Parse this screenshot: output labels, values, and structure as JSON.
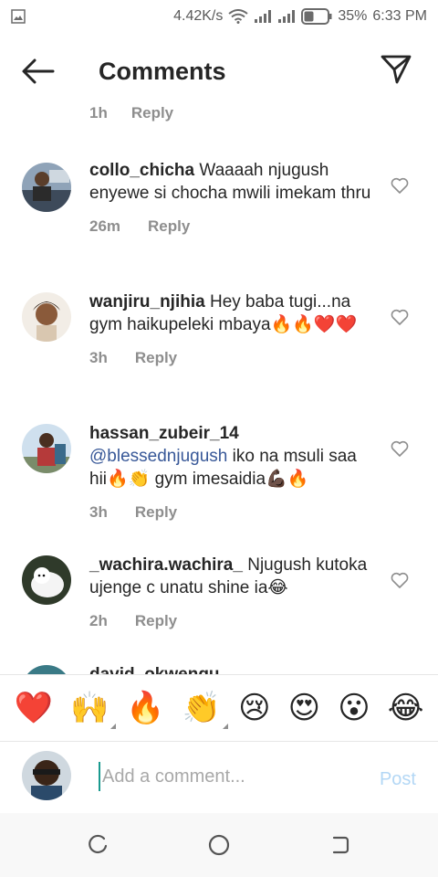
{
  "status": {
    "speed": "4.42K/s",
    "battery": "35%",
    "time": "6:33 PM",
    "icons": [
      "gallery-icon",
      "wifi-icon",
      "signal-icon",
      "battery-icon"
    ]
  },
  "header": {
    "title": "Comments",
    "back_icon": "arrow-left-icon",
    "send_icon": "paper-plane-icon"
  },
  "partial": {
    "time": "1h",
    "reply": "Reply"
  },
  "comments": [
    {
      "username": "collo_chicha",
      "mention": "",
      "text": "Waaaah njugush enyewe si chocha mwili imekam thru",
      "time": "26m",
      "reply": "Reply"
    },
    {
      "username": "wanjiru_njihia",
      "mention": "",
      "text": "Hey baba tugi...na gym haikupeleki mbaya🔥🔥❤️❤️",
      "time": "3h",
      "reply": "Reply"
    },
    {
      "username": "hassan_zubeir_14",
      "mention": "@blessednjugush",
      "text": "iko na msuli saa hii🔥👏 gym imesaidia💪🏿🔥",
      "time": "3h",
      "reply": "Reply"
    },
    {
      "username": "_wachira.wachira_",
      "mention": "",
      "text": "Njugush kutoka ujenge c unatu shine ia😂",
      "time": "2h",
      "reply": "Reply"
    },
    {
      "username": "david_okwengu",
      "mention": "",
      "text": "",
      "time": "",
      "reply": ""
    }
  ],
  "emojis": [
    "❤️",
    "🙌",
    "🔥",
    "👏",
    "😢",
    "😍",
    "😮",
    "😂"
  ],
  "input": {
    "placeholder": "Add a comment...",
    "value": "",
    "post_label": "Post"
  },
  "colors": {
    "mention": "#385898",
    "meta": "#8e8e8e",
    "post_disabled": "#b3d7f5",
    "cursor": "#1a9a8f"
  }
}
